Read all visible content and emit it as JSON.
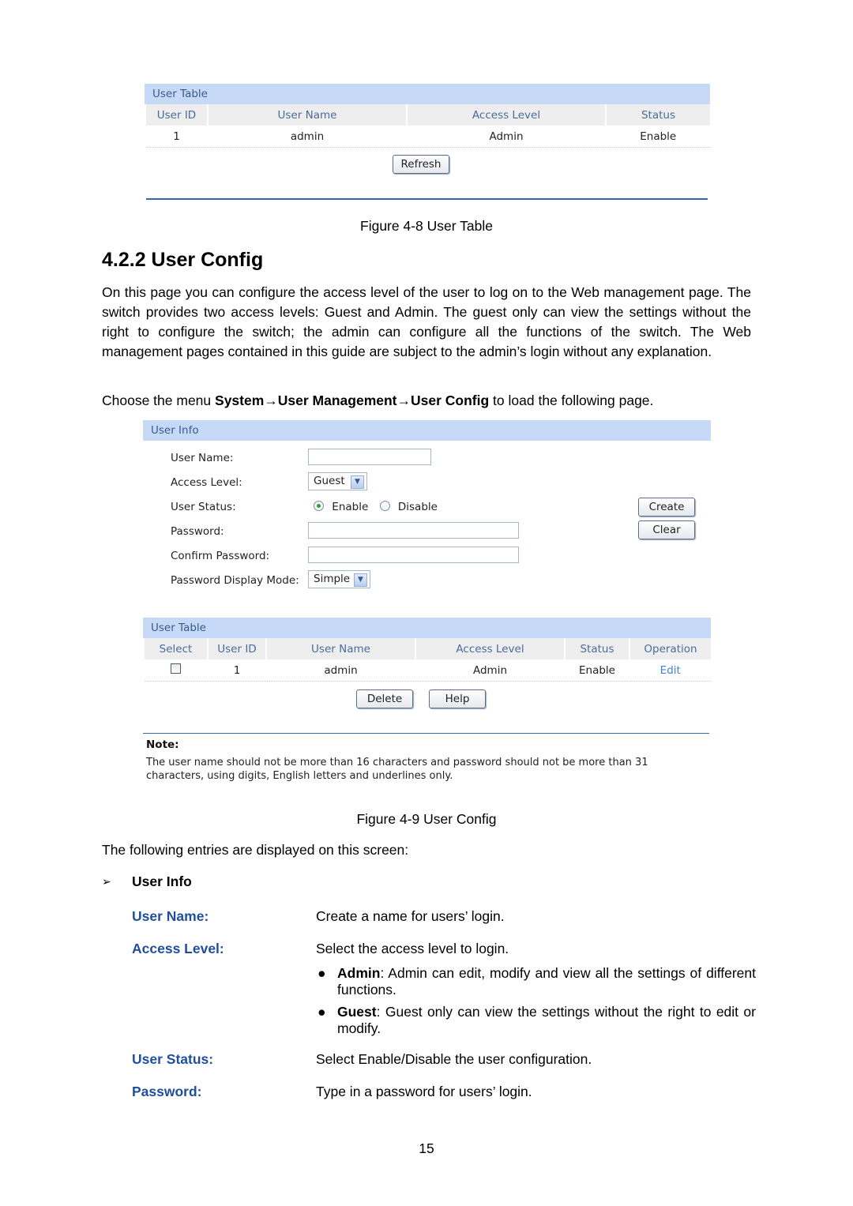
{
  "figure8": {
    "panel_title": "User Table",
    "columns": [
      "User ID",
      "User Name",
      "Access Level",
      "Status"
    ],
    "rows": [
      {
        "user_id": "1",
        "user_name": "admin",
        "access_level": "Admin",
        "status": "Enable"
      }
    ],
    "refresh_label": "Refresh",
    "caption": "Figure 4-8 User Table"
  },
  "section": {
    "heading": "4.2.2 User Config",
    "intro": "On this page you can configure the access level of the user to log on to the Web management page. The switch provides two access levels: Guest and Admin. The guest only can view the settings without the right to configure the switch; the admin can configure all the functions of the switch. The Web management pages contained in this guide are subject to the admin’s login without any explanation.",
    "menu_prefix": "Choose the menu ",
    "menu_path": "System→User Management→User Config",
    "menu_suffix": " to load the following page."
  },
  "figure9": {
    "user_info": {
      "title": "User Info",
      "user_name_label": "User Name:",
      "user_name_value": "",
      "access_level_label": "Access Level:",
      "access_level_value": "Guest",
      "user_status_label": "User Status:",
      "status_enable": "Enable",
      "status_disable": "Disable",
      "status_selected": "Enable",
      "password_label": "Password:",
      "password_value": "",
      "confirm_password_label": "Confirm Password:",
      "confirm_password_value": "",
      "display_mode_label": "Password Display Mode:",
      "display_mode_value": "Simple",
      "create_label": "Create",
      "clear_label": "Clear"
    },
    "user_table": {
      "title": "User Table",
      "columns": [
        "Select",
        "User ID",
        "User Name",
        "Access Level",
        "Status",
        "Operation"
      ],
      "rows": [
        {
          "selected": false,
          "user_id": "1",
          "user_name": "admin",
          "access_level": "Admin",
          "status": "Enable",
          "operation": "Edit"
        }
      ],
      "delete_label": "Delete",
      "help_label": "Help"
    },
    "note_title": "Note:",
    "note_text": "The user name should not be more than 16 characters and password should not be more than 31 characters, using digits, English letters and underlines only.",
    "caption": "Figure 4-9 User Config"
  },
  "entries": {
    "lead": "The following entries are displayed on this screen:",
    "group_marker": "➢",
    "group_title": "User Info",
    "items": [
      {
        "term": "User Name:",
        "desc": "Create a name for users’ login."
      },
      {
        "term": "Access Level:",
        "desc": "Select the access level to login."
      },
      {
        "term": "User Status:",
        "desc": "Select Enable/Disable the user configuration."
      },
      {
        "term": "Password:",
        "desc": "Type in a password for users’ login."
      }
    ],
    "bullets": [
      {
        "bold": "Admin",
        "text": ": Admin can edit, modify and view all the settings of different functions."
      },
      {
        "bold": "Guest",
        "text": ": Guest only can view the settings without the right to edit or modify."
      }
    ]
  },
  "page_number": "15"
}
